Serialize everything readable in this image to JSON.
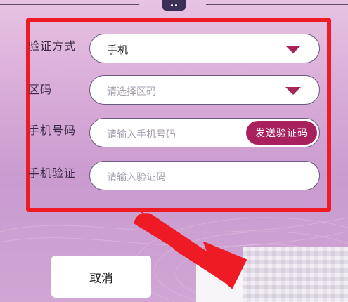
{
  "form": {
    "method": {
      "label": "验证方式",
      "value": "手机"
    },
    "region": {
      "label": "区码",
      "placeholder": "请选择区码"
    },
    "phone": {
      "label": "手机号码",
      "placeholder": "请输入手机号码",
      "send_code": "发送验证码"
    },
    "code": {
      "label": "手机验证",
      "placeholder": "请输入验证码"
    }
  },
  "buttons": {
    "cancel": "取消"
  },
  "icons": {
    "top_handle": "more-dots-icon",
    "dropdown": "triangle-down-icon",
    "annotation": "red-arrow-icon"
  },
  "colors": {
    "accent": "#a8205d",
    "highlight": "#ee1b24"
  }
}
